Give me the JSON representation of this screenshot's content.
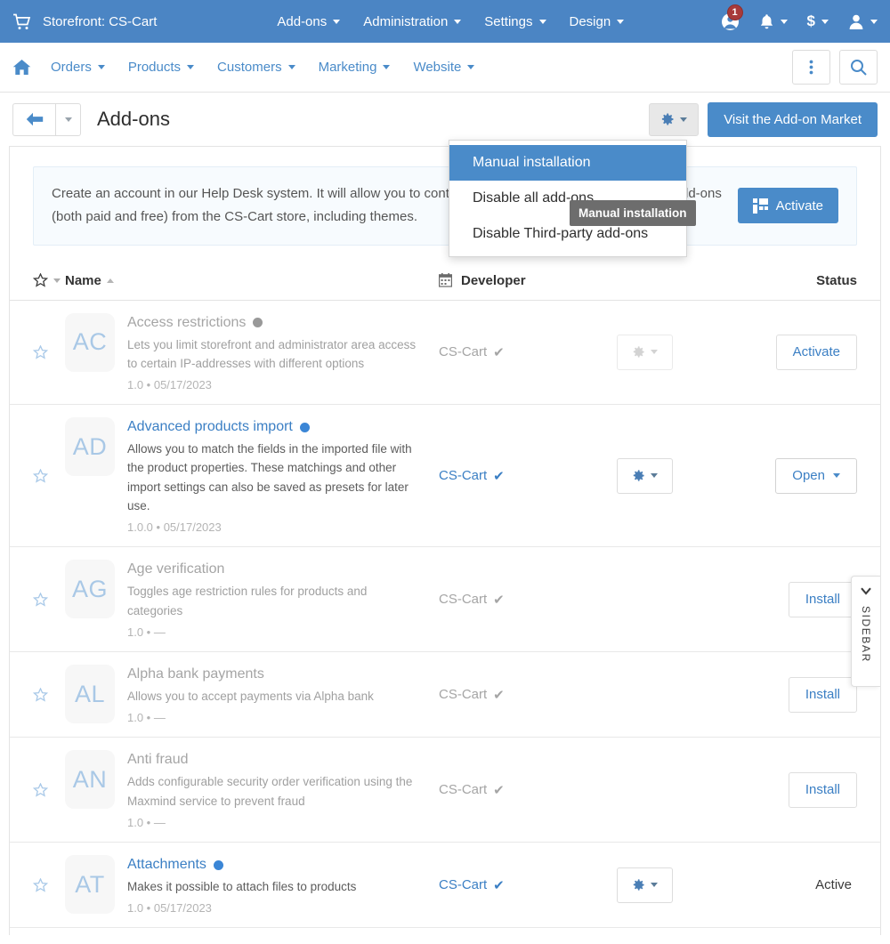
{
  "topbar": {
    "cart_icon": "cart-icon",
    "storefront_label": "Storefront: CS-Cart",
    "menu": [
      {
        "label": "Add-ons"
      },
      {
        "label": "Administration"
      },
      {
        "label": "Settings"
      },
      {
        "label": "Design"
      }
    ],
    "help_badge": "1",
    "currency_symbol": "$",
    "accent_color": "#4b85c4"
  },
  "navbar": {
    "home_icon": "home-icon",
    "items": [
      {
        "label": "Orders"
      },
      {
        "label": "Products"
      },
      {
        "label": "Customers"
      },
      {
        "label": "Marketing"
      },
      {
        "label": "Website"
      }
    ],
    "more_icon": "vertical-ellipsis-icon",
    "search_icon": "search-icon",
    "link_color": "#4a8bc9"
  },
  "page_header": {
    "back_icon": "arrow-left-icon",
    "title": "Add-ons",
    "gear_icon": "gear-icon",
    "market_button": "Visit the Add-on Market"
  },
  "dropdown": {
    "items": [
      {
        "label": "Manual installation",
        "selected": true
      },
      {
        "label": "Disable all add-ons",
        "selected": false
      },
      {
        "label": "Disable Third-party add-ons",
        "selected": false
      }
    ],
    "tooltip": "Manual installation",
    "highlight_color": "#4a8bc9"
  },
  "notice": {
    "text": "Create an account in our Help Desk system. It will allow you to contact our Customer Care team, and get add-ons (both paid and free) from the CS-Cart store, including themes.",
    "button_label": "Activate",
    "button_icon": "blocks-icon",
    "background": "#f7fbfe"
  },
  "table": {
    "headers": {
      "star": "star-icon",
      "name": "Name",
      "calendar": "calendar-icon",
      "developer": "Developer",
      "status": "Status"
    },
    "rows": [
      {
        "initials": "AC",
        "name": "Access restrictions",
        "status_dot": "grey",
        "description": "Lets you limit storefront and administrator area access to certain IP-addresses with different options",
        "version": "1.0 • 05/17/2023",
        "developer": "CS-Cart",
        "developer_active": false,
        "gear": true,
        "gear_enabled": false,
        "action_type": "button",
        "action_label": "Activate",
        "action_caret": false,
        "faded": true,
        "link": false
      },
      {
        "initials": "AD",
        "name": "Advanced products import",
        "status_dot": "blue",
        "description": "Allows you to match the fields in the imported file with the product properties. These matchings and other import settings can also be saved as presets for later use.",
        "version": "1.0.0 • 05/17/2023",
        "developer": "CS-Cart",
        "developer_active": true,
        "gear": true,
        "gear_enabled": true,
        "action_type": "button",
        "action_label": "Open",
        "action_caret": true,
        "faded": false,
        "link": true
      },
      {
        "initials": "AG",
        "name": "Age verification",
        "status_dot": "none",
        "description": "Toggles age restriction rules for products and categories",
        "version": "1.0 • —",
        "developer": "CS-Cart",
        "developer_active": false,
        "gear": false,
        "gear_enabled": false,
        "action_type": "button",
        "action_label": "Install",
        "action_caret": false,
        "faded": true,
        "link": false
      },
      {
        "initials": "AL",
        "name": "Alpha bank payments",
        "status_dot": "none",
        "description": "Allows you to accept payments via Alpha bank",
        "version": "1.0 • —",
        "developer": "CS-Cart",
        "developer_active": false,
        "gear": false,
        "gear_enabled": false,
        "action_type": "button",
        "action_label": "Install",
        "action_caret": false,
        "faded": true,
        "link": false
      },
      {
        "initials": "AN",
        "name": "Anti fraud",
        "status_dot": "none",
        "description": "Adds configurable security order verification using the Maxmind service to prevent fraud",
        "version": "1.0 • —",
        "developer": "CS-Cart",
        "developer_active": false,
        "gear": false,
        "gear_enabled": false,
        "action_type": "button",
        "action_label": "Install",
        "action_caret": false,
        "faded": true,
        "link": false
      },
      {
        "initials": "AT",
        "name": "Attachments",
        "status_dot": "blue",
        "description": "Makes it possible to attach files to products",
        "version": "1.0 • 05/17/2023",
        "developer": "CS-Cart",
        "developer_active": true,
        "gear": true,
        "gear_enabled": true,
        "action_type": "text",
        "action_label": "Active",
        "action_caret": false,
        "faded": false,
        "link": true
      }
    ]
  },
  "sidebar_tab": {
    "label": "SIDEBAR",
    "chevron_icon": "chevron-left-icon"
  }
}
